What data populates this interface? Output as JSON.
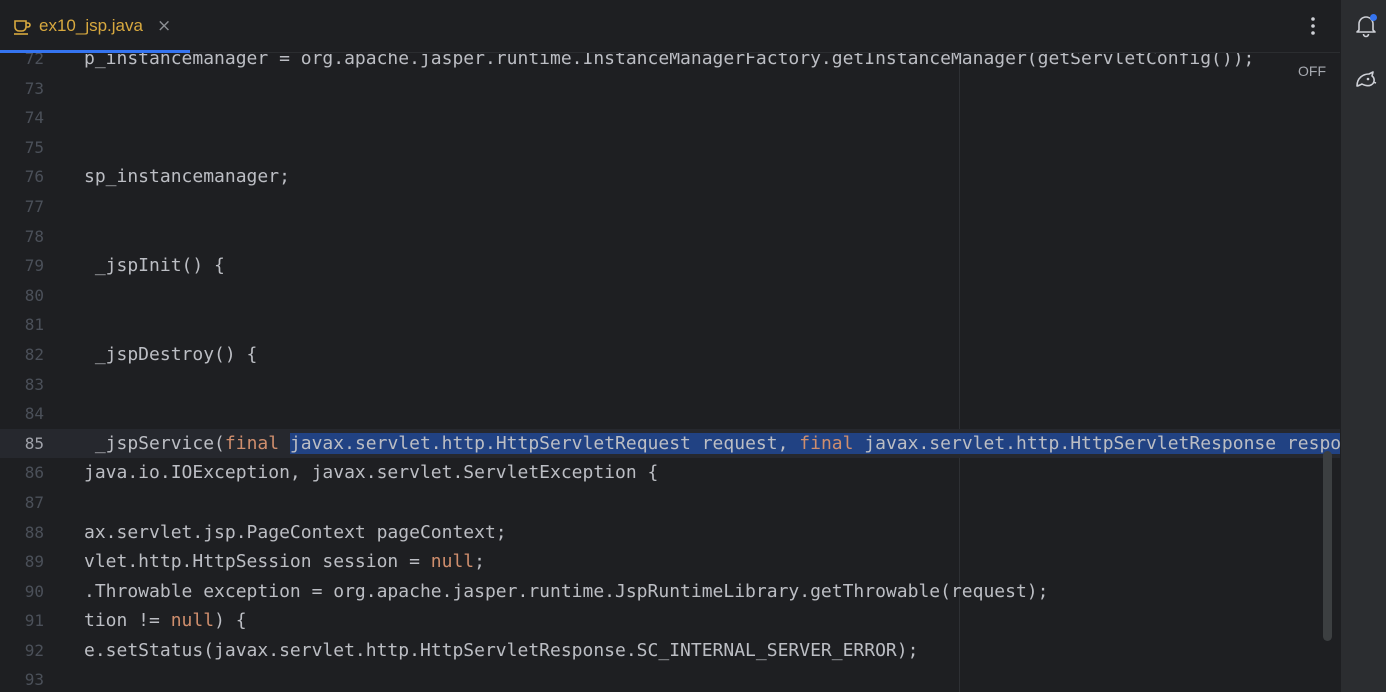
{
  "tab": {
    "label": "ex10_jsp.java",
    "close_glyph": "×",
    "icon": "coffee-cup-icon",
    "icon_color": "#d8a93f",
    "active_underline_color": "#3574f0"
  },
  "toolbar": {
    "more_icon": "vertical-ellipsis-icon",
    "notifications_icon": "bell-icon",
    "ai_assistant_icon": "ai-assistant-icon"
  },
  "editor": {
    "inlay_label": "OFF",
    "current_line": "85",
    "colors": {
      "keyword": "#cf8e6d",
      "selection": "#214283",
      "text": "#bcbec4"
    },
    "lines": [
      {
        "num": "72",
        "text": "p_instancemanager = org.apache.jasper.runtime.InstanceManagerFactory.getInstanceManager(getServletConfig());"
      },
      {
        "num": "73",
        "text": ""
      },
      {
        "num": "74",
        "text": ""
      },
      {
        "num": "75",
        "text": ""
      },
      {
        "num": "76",
        "text": "sp_instancemanager;"
      },
      {
        "num": "77",
        "text": ""
      },
      {
        "num": "78",
        "text": ""
      },
      {
        "num": "79",
        "text": " _jspInit() {"
      },
      {
        "num": "80",
        "text": ""
      },
      {
        "num": "81",
        "text": ""
      },
      {
        "num": "82",
        "text": " _jspDestroy() {"
      },
      {
        "num": "83",
        "text": ""
      },
      {
        "num": "84",
        "text": ""
      },
      {
        "num": "85",
        "parts": [
          {
            "t": " _jspService("
          },
          {
            "t": "final",
            "k": "kw"
          },
          {
            "t": " "
          },
          {
            "t": "javax.servlet.http.HttpServletRequest request, ",
            "k": "sel"
          },
          {
            "t": "final",
            "k": "kw sel"
          },
          {
            "t": " javax.servlet.http.HttpServletResponse response",
            "k": "sel"
          },
          {
            "caret": true
          },
          {
            "t": ")"
          }
        ]
      },
      {
        "num": "86",
        "text": "java.io.IOException, javax.servlet.ServletException {"
      },
      {
        "num": "87",
        "text": ""
      },
      {
        "num": "88",
        "text": "ax.servlet.jsp.PageContext pageContext;"
      },
      {
        "num": "89",
        "parts": [
          {
            "t": "vlet.http.HttpSession session = "
          },
          {
            "t": "null",
            "k": "kw"
          },
          {
            "t": ";"
          }
        ]
      },
      {
        "num": "90",
        "text": ".Throwable exception = org.apache.jasper.runtime.JspRuntimeLibrary.getThrowable(request);"
      },
      {
        "num": "91",
        "parts": [
          {
            "t": "tion != "
          },
          {
            "t": "null",
            "k": "kw"
          },
          {
            "t": ") {"
          }
        ]
      },
      {
        "num": "92",
        "text": "e.setStatus(javax.servlet.http.HttpServletResponse.SC_INTERNAL_SERVER_ERROR);"
      },
      {
        "num": "93",
        "text": ""
      }
    ]
  }
}
